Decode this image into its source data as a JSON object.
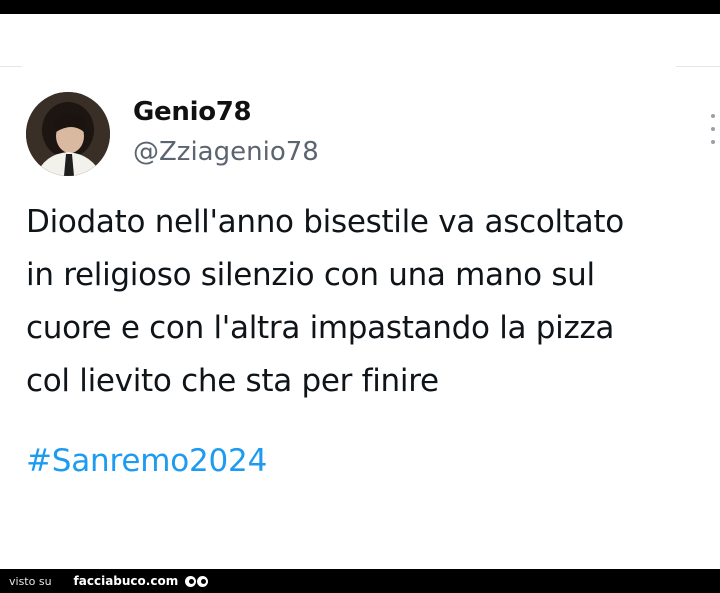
{
  "tweet": {
    "display_name": "Genio78",
    "handle": "@Zziagenio78",
    "text_lines": [
      "Diodato nell'anno bisestile va ascoltato",
      "in religioso silenzio con una mano sul",
      "cuore e con l'altra impastando la pizza",
      "col lievito che sta per finire"
    ],
    "hashtag": "#Sanremo2024"
  },
  "footer": {
    "visto_su": "visto su",
    "brand": "facciabuco.com"
  },
  "icons": {
    "more": "more-vertical-icon",
    "eyes": "eyes-logo-icon"
  },
  "colors": {
    "hashtag": "#1d9bf0",
    "handle": "#5b6570",
    "text": "#0f1419"
  }
}
